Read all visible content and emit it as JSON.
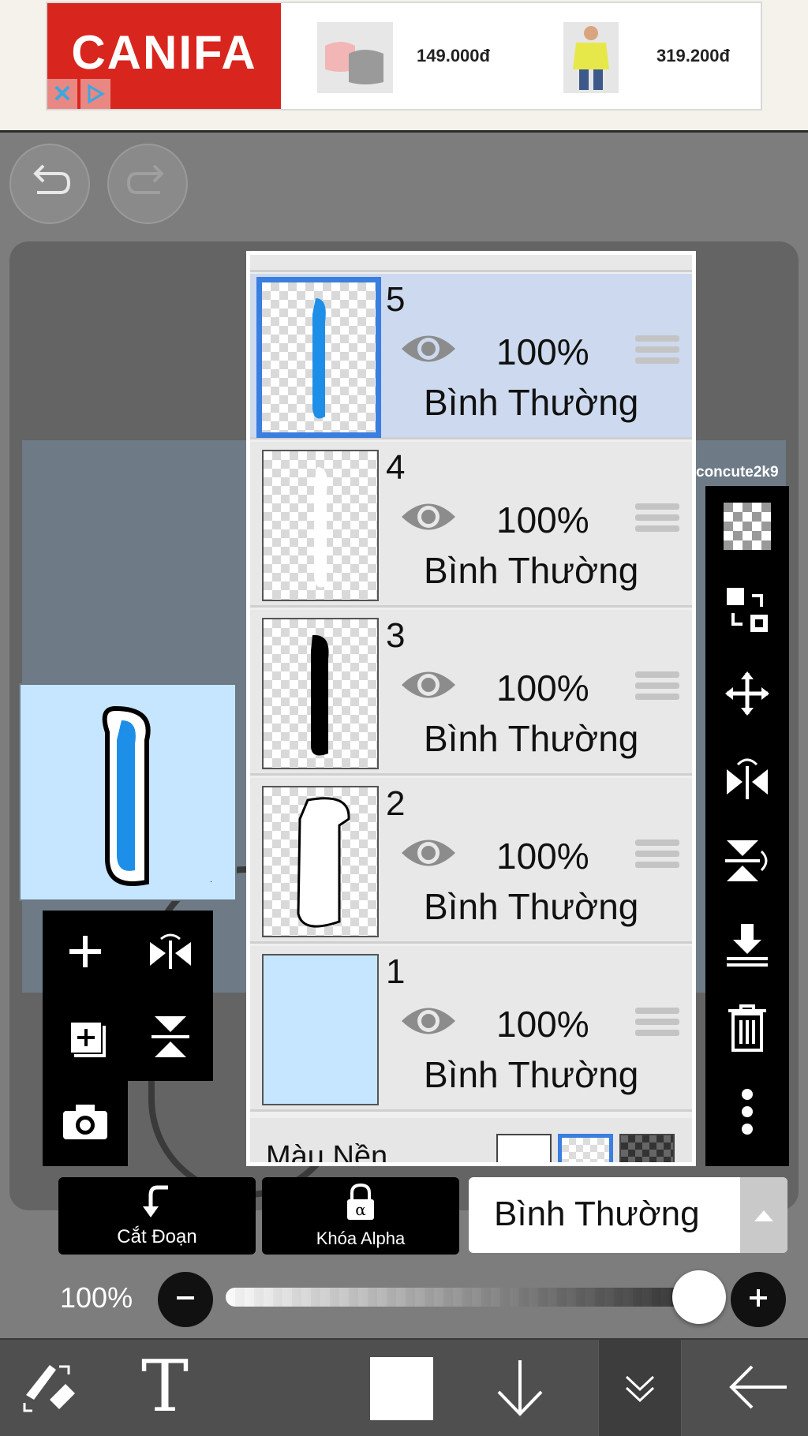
{
  "ad": {
    "brand": "CANIFA",
    "products": [
      {
        "price": "149.000đ"
      },
      {
        "price": "319.200đ"
      }
    ]
  },
  "canvas": {
    "watermark": "concute2k9"
  },
  "layers": [
    {
      "number": "5",
      "opacity": "100%",
      "mode": "Bình Thường"
    },
    {
      "number": "4",
      "opacity": "100%",
      "mode": "Bình Thường"
    },
    {
      "number": "3",
      "opacity": "100%",
      "mode": "Bình Thường"
    },
    {
      "number": "2",
      "opacity": "100%",
      "mode": "Bình Thường"
    },
    {
      "number": "1",
      "opacity": "100%",
      "mode": "Bình Thường"
    }
  ],
  "background_row": {
    "label": "Màu Nền"
  },
  "actions": {
    "clipping": "Cắt Đoạn",
    "alpha_lock": "Khóa Alpha",
    "blend_mode": "Bình Thường"
  },
  "opacity": {
    "label": "100%",
    "value": 1.0
  },
  "colors": {
    "accent": "#3a7ee0",
    "layer1_fill": "#c6e6ff",
    "ad_red": "#d8261e"
  }
}
